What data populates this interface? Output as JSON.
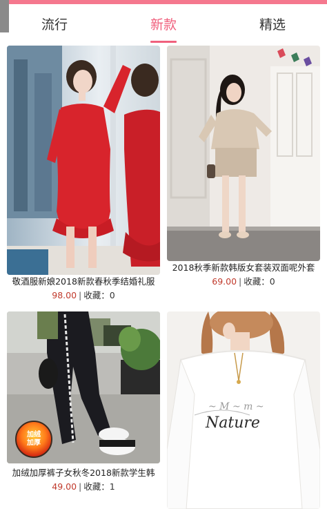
{
  "tabs": [
    {
      "label": "流行",
      "active": false
    },
    {
      "label": "新款",
      "active": true
    },
    {
      "label": "精选",
      "active": false
    }
  ],
  "accent_color": "#f0607d",
  "price_color": "#c0392b",
  "items": [
    {
      "title": "敬酒服新娘2018新款春秋季结婚礼服",
      "price": "98.00",
      "favorites_label": "收藏：",
      "favorites": "0",
      "image": "red-dress-photo"
    },
    {
      "title": "2018秋季新款韩版女套装双面呢外套",
      "price": "69.00",
      "favorites_label": "收藏：",
      "favorites": "0",
      "image": "beige-jacket-skirt-set-photo"
    },
    {
      "title": "加绒加厚裤子女秋冬2018新款学生韩",
      "price": "49.00",
      "favorites_label": "收藏：",
      "favorites": "1",
      "image": "black-sweatpants-photo",
      "badge_line1": "加绒",
      "badge_line2": "加厚"
    },
    {
      "title": "",
      "price": "",
      "favorites_label": "",
      "favorites": "",
      "image": "white-sweatshirt-photo",
      "print_text": "Nature"
    }
  ]
}
